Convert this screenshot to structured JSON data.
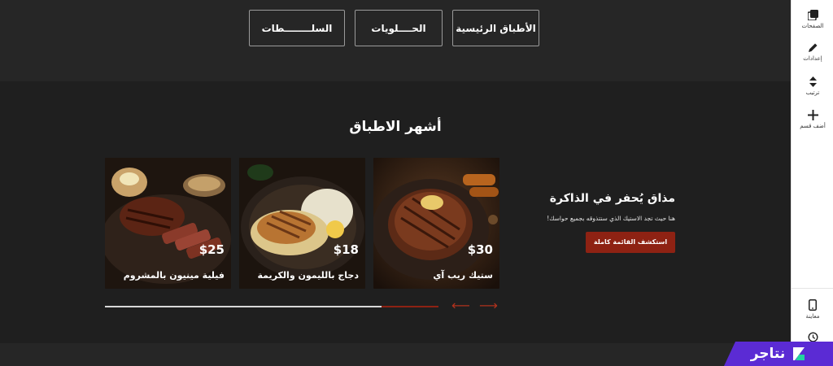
{
  "categories": [
    {
      "label": "الأطباق الرئيسية"
    },
    {
      "label": "الحــــلويات"
    },
    {
      "label": "السلــــــــطات"
    }
  ],
  "section": {
    "title": "أشهر الاطباق",
    "intro_title": "مذاق يُحفر في الذاكرة",
    "intro_desc": "هنا حيث تجد الاستيك الذي ستتذوقه بجميع حواسك!",
    "cta_label": "استكشف القائمة كاملة"
  },
  "dishes": [
    {
      "name": "ستيك ريب آي",
      "price": "$30"
    },
    {
      "name": "دجاج بالليمون والكريمة",
      "price": "$18"
    },
    {
      "name": "فيلية مينيون بالمشروم",
      "price": "$25"
    }
  ],
  "carousel": {
    "progress": 0.83,
    "prev_arrow": "⟵",
    "next_arrow": "⟶"
  },
  "sidebar": {
    "pages_label": "الصفحات",
    "settings_label": "إعدادات",
    "order_label": "ترتيب",
    "add_section_label": "أضف قسم",
    "preview_label": "معاينة"
  },
  "brand": {
    "name": "نتاجر"
  },
  "colors": {
    "accent": "#8e2213",
    "brand": "#5b2bd4",
    "background": "#1f1f1f"
  }
}
